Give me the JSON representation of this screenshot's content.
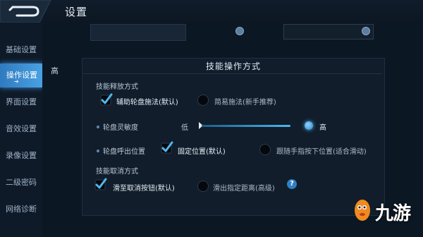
{
  "header": {
    "title": "设置"
  },
  "sidebar": {
    "items": [
      {
        "label": "基础设置"
      },
      {
        "label": "操作设置",
        "active": true
      },
      {
        "label": "界面设置"
      },
      {
        "label": "音效设置"
      },
      {
        "label": "录像设置"
      },
      {
        "label": "二级密码"
      },
      {
        "label": "网络诊断"
      }
    ]
  },
  "content": {
    "side_value": "高",
    "panel_title": "技能操作方式",
    "release": {
      "label": "技能释放方式",
      "options": [
        {
          "label": "辅助轮盘施法(默认)",
          "checked": true
        },
        {
          "label": "简易施法(新手推荐)",
          "checked": false
        }
      ]
    },
    "sensitivity": {
      "label": "轮盘灵敏度",
      "low_label": "低",
      "high_label": "高",
      "level": 1.0
    },
    "position": {
      "label": "轮盘呼出位置",
      "options": [
        {
          "label": "固定位置(默认)",
          "checked": true
        },
        {
          "label": "跟随手指按下位置(适合滑动)",
          "checked": false
        }
      ]
    },
    "cancel": {
      "label": "技能取消方式",
      "options": [
        {
          "label": "滑至取消按钮(默认)",
          "checked": true
        },
        {
          "label": "滑出指定距离(高级)",
          "checked": false
        }
      ],
      "help": "?"
    }
  },
  "logo": {
    "text": "九游"
  },
  "colors": {
    "accent": "#3d8fd8",
    "background": "#0b1522"
  }
}
